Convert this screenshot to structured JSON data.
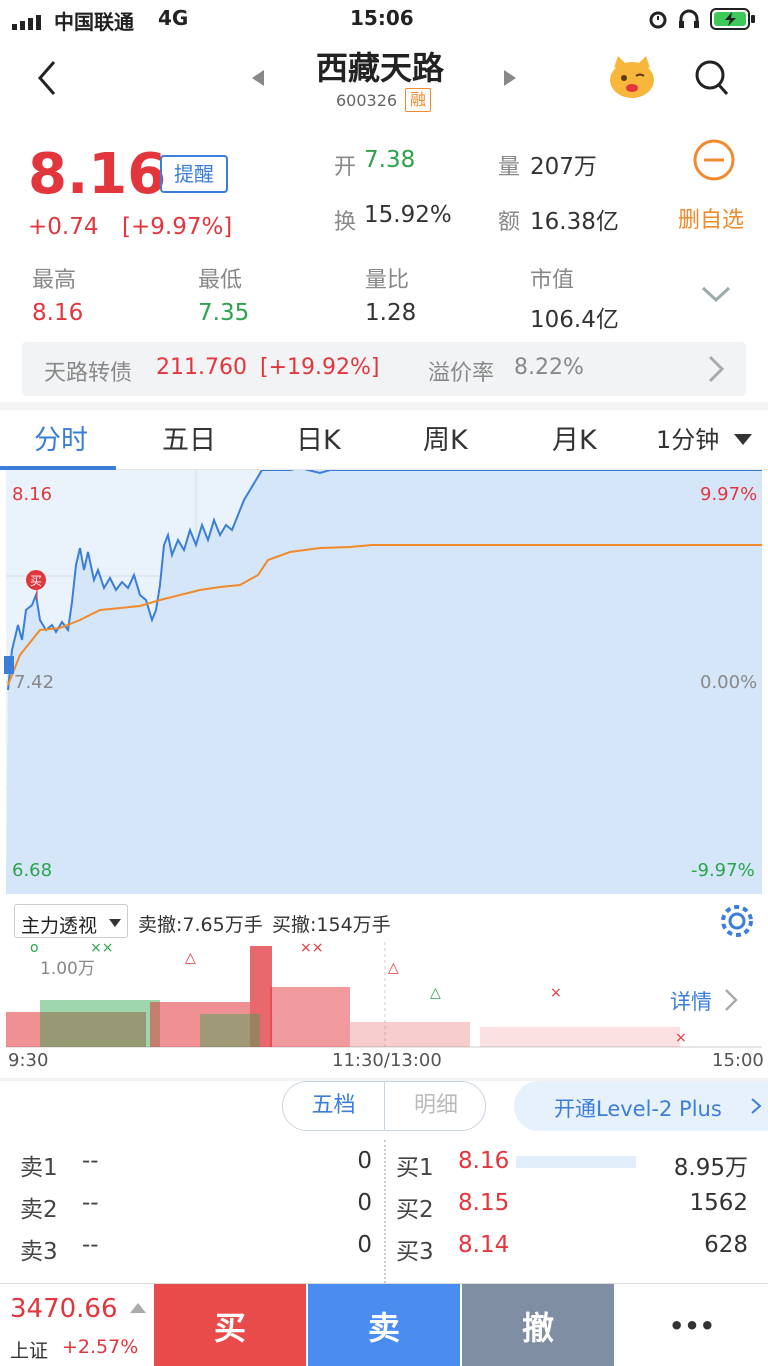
{
  "status_bar": {
    "carrier": "中国联通",
    "network": "4G",
    "time": "15:06"
  },
  "header": {
    "title": "西藏天路",
    "code": "600326",
    "margin_badge": "融"
  },
  "quote": {
    "price": "8.16",
    "remind_label": "提醒",
    "change": "+0.74",
    "change_pct": "[+9.97%]",
    "open_label": "开",
    "open": "7.38",
    "volume_label": "量",
    "volume": "207万",
    "turnover_label": "换",
    "turnover": "15.92%",
    "amount_label": "额",
    "amount": "16.38亿",
    "remove_watch_label": "删自选",
    "high_label": "最高",
    "high": "8.16",
    "low_label": "最低",
    "low": "7.35",
    "vol_ratio_label": "量比",
    "vol_ratio": "1.28",
    "mkt_cap_label": "市值",
    "mkt_cap": "106.4亿"
  },
  "bond": {
    "name": "天路转债",
    "price": "211.760",
    "change_pct": "[+19.92%]",
    "premium_label": "溢价率",
    "premium": "8.22%"
  },
  "tabs": [
    "分时",
    "五日",
    "日K",
    "周K",
    "月K",
    "1分钟"
  ],
  "chart": {
    "y_max": "8.16",
    "y_mid": "7.42",
    "y_min": "6.68",
    "pct_max": "9.97%",
    "pct_mid": "0.00%",
    "pct_min": "-9.97%",
    "sell_marker": "买"
  },
  "chart_data": {
    "type": "line",
    "series": [],
    "ylim": [
      6.68,
      8.16
    ]
  },
  "volume": {
    "indicator": "主力透视",
    "sell_cancel": "卖撤:7.65万手",
    "buy_cancel": "买撤:154万手",
    "scale": "1.00万",
    "detail_label": "详情",
    "time_start": "9:30",
    "time_mid": "11:30/13:00",
    "time_end": "15:00"
  },
  "orderbook": {
    "tab_five": "五档",
    "tab_detail": "明细",
    "level2": "开通Level-2 Plus",
    "sells": [
      {
        "label": "卖1",
        "price": "--",
        "qty": "0"
      },
      {
        "label": "卖2",
        "price": "--",
        "qty": "0"
      },
      {
        "label": "卖3",
        "price": "--",
        "qty": "0"
      }
    ],
    "buys": [
      {
        "label": "买1",
        "price": "8.16",
        "qty": "8.95万"
      },
      {
        "label": "买2",
        "price": "8.15",
        "qty": "1562"
      },
      {
        "label": "买3",
        "price": "8.14",
        "qty": "628"
      }
    ]
  },
  "index": {
    "value": "3470.66",
    "name": "上证",
    "change_pct": "+2.57%"
  },
  "actions": {
    "buy": "买",
    "sell": "卖",
    "cancel": "撤",
    "more": "•••"
  },
  "colors": {
    "up": "#e2363c",
    "down": "#2ba44b",
    "line": "#3a7ed9",
    "avg": "#f08a2c"
  }
}
